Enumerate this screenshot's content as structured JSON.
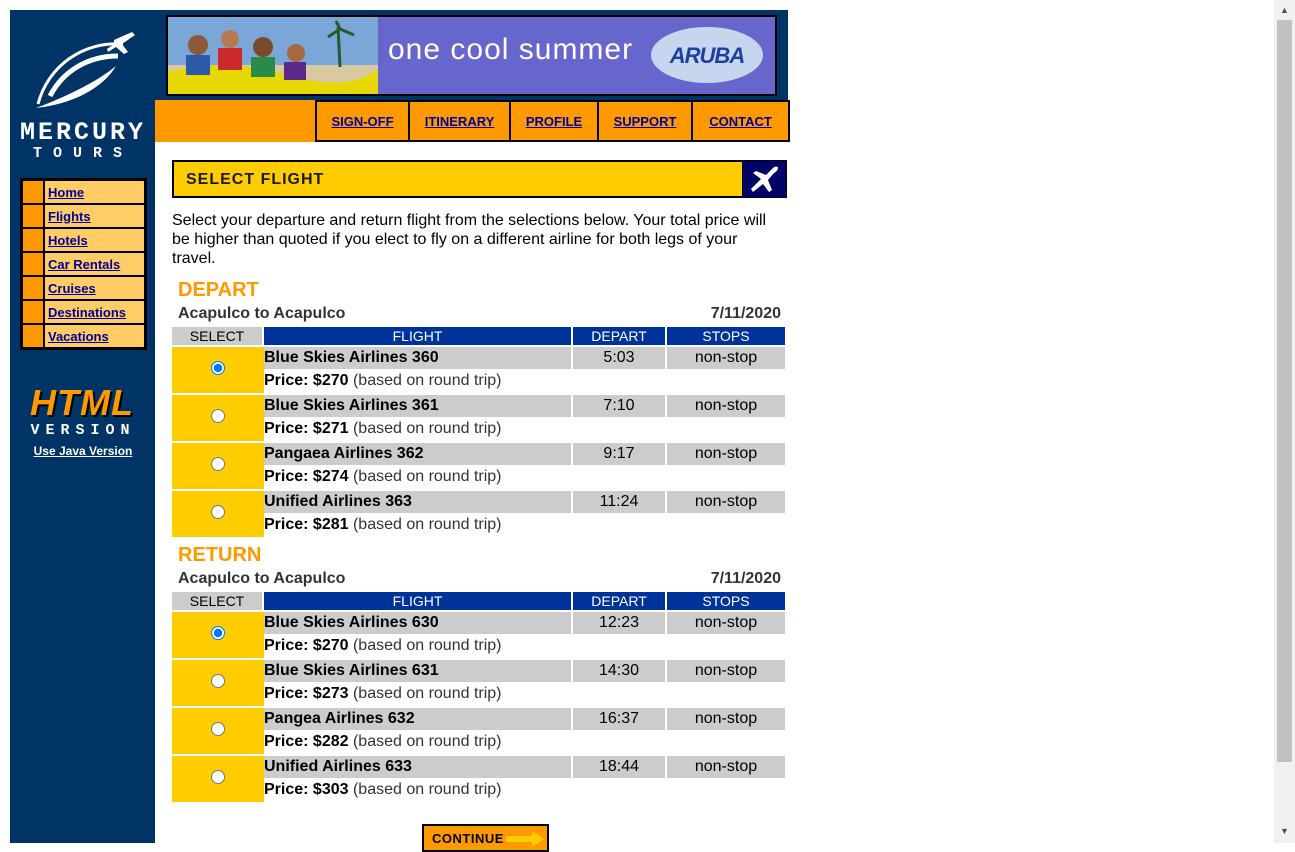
{
  "brand": {
    "name_top": "MERCURY",
    "name_bottom": "TOURS"
  },
  "banner": {
    "text": "one cool summer",
    "logo": "ARUBA"
  },
  "menu": [
    {
      "label": "SIGN-OFF"
    },
    {
      "label": "ITINERARY"
    },
    {
      "label": "PROFILE"
    },
    {
      "label": "SUPPORT"
    },
    {
      "label": "CONTACT"
    }
  ],
  "sidebar": {
    "items": [
      {
        "label": "Home"
      },
      {
        "label": "Flights"
      },
      {
        "label": "Hotels"
      },
      {
        "label": "Car Rentals"
      },
      {
        "label": "Cruises"
      },
      {
        "label": "Destinations"
      },
      {
        "label": "Vacations"
      }
    ],
    "html_badge": {
      "top": "HTML",
      "bottom": "VERSION"
    },
    "java_link": "Use Java Version"
  },
  "page": {
    "title": "SELECT FLIGHT",
    "intro": "Select your departure and return flight from the selections below. Your total price will be higher than quoted if you elect to fly on a different airline for both legs of your travel."
  },
  "columns": {
    "select": "SELECT",
    "flight": "FLIGHT",
    "depart": "DEPART",
    "stops": "STOPS"
  },
  "depart": {
    "heading": "DEPART",
    "route": "Acapulco to Acapulco",
    "date": "7/11/2020",
    "flights": [
      {
        "airline": "Blue Skies Airlines 360",
        "time": "5:03",
        "stops": "non-stop",
        "price_label": "Price: $270",
        "price_note": "(based on round trip)",
        "selected": true
      },
      {
        "airline": "Blue Skies Airlines 361",
        "time": "7:10",
        "stops": "non-stop",
        "price_label": "Price: $271",
        "price_note": "(based on round trip)",
        "selected": false
      },
      {
        "airline": "Pangaea Airlines 362",
        "time": "9:17",
        "stops": "non-stop",
        "price_label": "Price: $274",
        "price_note": "(based on round trip)",
        "selected": false
      },
      {
        "airline": "Unified Airlines 363",
        "time": "11:24",
        "stops": "non-stop",
        "price_label": "Price: $281",
        "price_note": "(based on round trip)",
        "selected": false
      }
    ]
  },
  "return": {
    "heading": "RETURN",
    "route": "Acapulco to Acapulco",
    "date": "7/11/2020",
    "flights": [
      {
        "airline": "Blue Skies Airlines 630",
        "time": "12:23",
        "stops": "non-stop",
        "price_label": "Price: $270",
        "price_note": "(based on round trip)",
        "selected": true
      },
      {
        "airline": "Blue Skies Airlines 631",
        "time": "14:30",
        "stops": "non-stop",
        "price_label": "Price: $273",
        "price_note": "(based on round trip)",
        "selected": false
      },
      {
        "airline": "Pangea Airlines 632",
        "time": "16:37",
        "stops": "non-stop",
        "price_label": "Price: $282",
        "price_note": "(based on round trip)",
        "selected": false
      },
      {
        "airline": "Unified Airlines 633",
        "time": "18:44",
        "stops": "non-stop",
        "price_label": "Price: $303",
        "price_note": "(based on round trip)",
        "selected": false
      }
    ]
  },
  "continue_label": "CONTINUE",
  "colors": {
    "navy": "#003366",
    "orange": "#ff9900",
    "yellow": "#ffcc00",
    "header_blue": "#003399",
    "link": "#000099"
  }
}
